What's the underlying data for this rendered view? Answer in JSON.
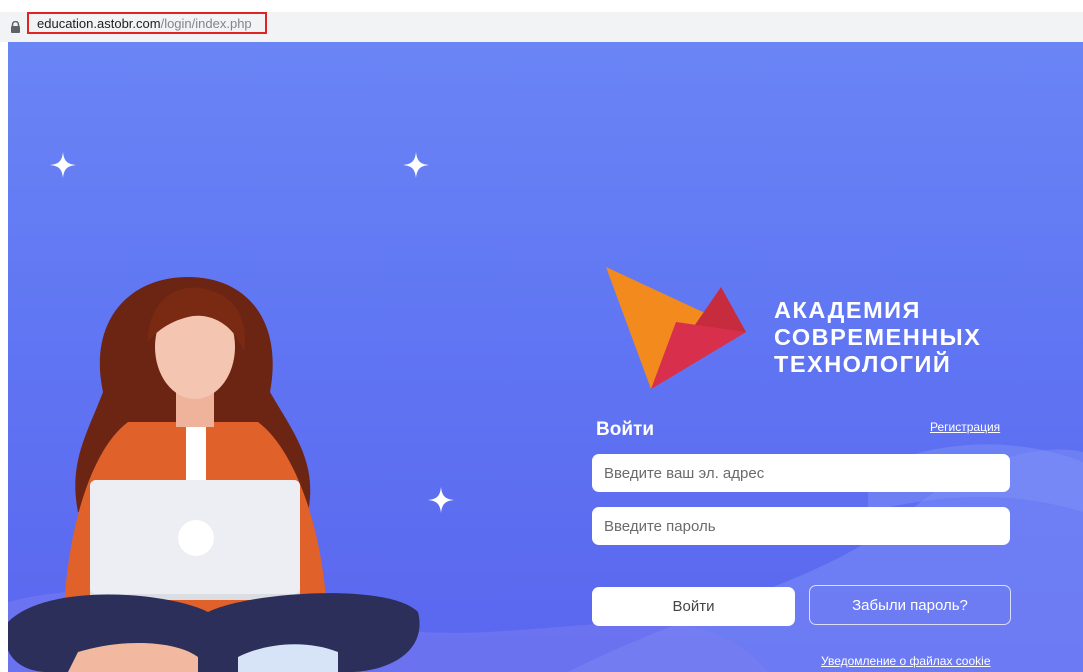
{
  "browser": {
    "url_host": "education.astobr.com",
    "url_path": "/login/index.php"
  },
  "logo": {
    "line1": "АКАДЕМИЯ",
    "line2": "СОВРЕМЕННЫХ",
    "line3": "ТЕХНОЛОГИЙ"
  },
  "login": {
    "title": "Войти",
    "register_link": "Регистрация",
    "email_placeholder": "Введите ваш эл. адрес",
    "password_placeholder": "Введите пароль",
    "submit_label": "Войти",
    "forgot_label": "Забыли пароль?"
  },
  "footer": {
    "cookie_link": "Уведомление о файлах cookie"
  },
  "colors": {
    "background_top": "#6a85f5",
    "background_bottom": "#5a66ef",
    "logo_orange": "#f28a1e",
    "logo_red": "#d0283e",
    "url_highlight": "#e02424"
  }
}
